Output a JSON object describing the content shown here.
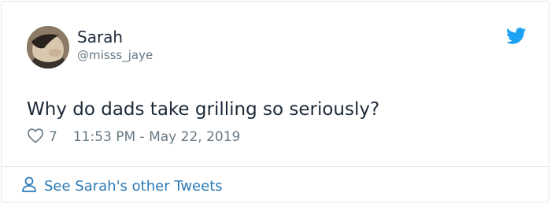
{
  "author": {
    "name": "Sarah",
    "handle": "@misss_jaye"
  },
  "tweet": {
    "text": "Why do dads take grilling so seriously?",
    "likes": "7",
    "timestamp": "11:53 PM - May 22, 2019"
  },
  "footer": {
    "link_label": "See Sarah's other Tweets"
  },
  "icons": {
    "brand": "twitter-bird-icon",
    "like": "heart-icon",
    "profile": "person-icon"
  },
  "colors": {
    "twitter_blue": "#1da1f2",
    "link_blue": "#2b7bb9",
    "text": "#1c2938",
    "muted": "#697882",
    "border": "#e1e8ed"
  }
}
